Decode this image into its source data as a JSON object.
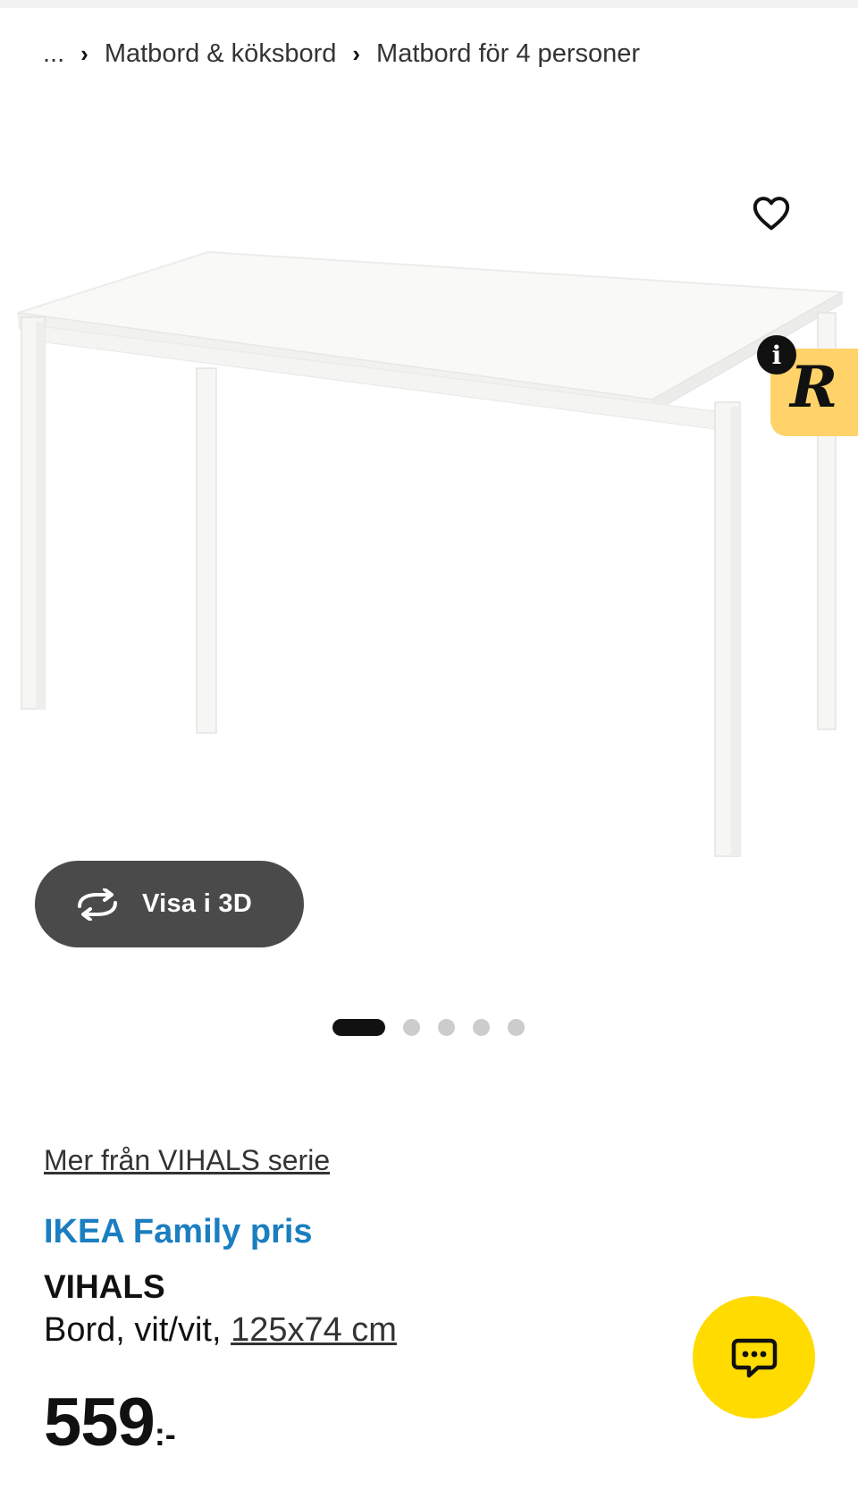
{
  "breadcrumb": {
    "ellipsis": "...",
    "items": [
      "Matbord & köksbord",
      "Matbord för 4 personer"
    ]
  },
  "gallery": {
    "image_subject": "white table",
    "view_3d_label": "Visa i 3D",
    "badge_letter": "R",
    "info_label": "i",
    "dots_total": 5,
    "dots_active": 1
  },
  "product": {
    "series_link": "Mer från VIHALS serie",
    "family_price_label": "IKEA Family pris",
    "name": "VIHALS",
    "desc_prefix": "Bord, vit/vit, ",
    "size_link": "125x74 cm",
    "price": "559",
    "price_suffix": ":-"
  },
  "colors": {
    "family_blue": "#1b7ec0",
    "chat_yellow": "#ffdb00",
    "badge_yellow": "#ffd36a",
    "button_grey": "#4a4a4a"
  },
  "icons": {
    "favorite": "heart-icon",
    "view_3d": "rotate-3d-icon",
    "chat": "chat-bubble-icon",
    "info": "info-icon"
  }
}
